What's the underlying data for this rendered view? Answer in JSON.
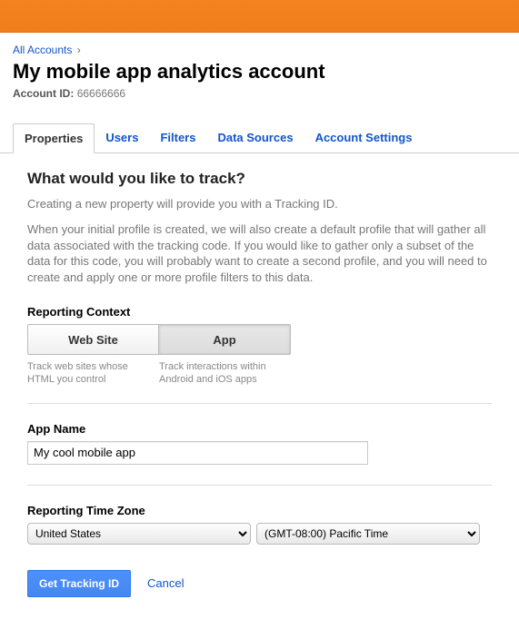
{
  "breadcrumb": {
    "all_accounts": "All Accounts",
    "sep": "›"
  },
  "header": {
    "title": "My mobile app analytics account",
    "account_id_label": "Account ID:",
    "account_id_value": "66666666"
  },
  "tabs": {
    "items": [
      {
        "label": "Properties",
        "active": true
      },
      {
        "label": "Users"
      },
      {
        "label": "Filters"
      },
      {
        "label": "Data Sources"
      },
      {
        "label": "Account Settings"
      }
    ]
  },
  "form": {
    "heading": "What would you like to track?",
    "intro1": "Creating a new property will provide you with a Tracking ID.",
    "intro2": "When your initial profile is created, we will also create a default profile that will gather all data associated with the tracking code. If you would like to gather only a subset of the data for this code, you will probably want to create a second profile, and you will need to create and apply one or more profile filters to this data.",
    "context": {
      "label": "Reporting Context",
      "website": {
        "label": "Web Site",
        "desc": "Track web sites whose HTML you control"
      },
      "app": {
        "label": "App",
        "desc": "Track interactions within Android and iOS apps"
      }
    },
    "app_name": {
      "label": "App Name",
      "value": "My cool mobile app"
    },
    "tz": {
      "label": "Reporting Time Zone",
      "country": "United States",
      "zone": "(GMT-08:00) Pacific Time"
    },
    "actions": {
      "submit": "Get Tracking ID",
      "cancel": "Cancel"
    }
  }
}
